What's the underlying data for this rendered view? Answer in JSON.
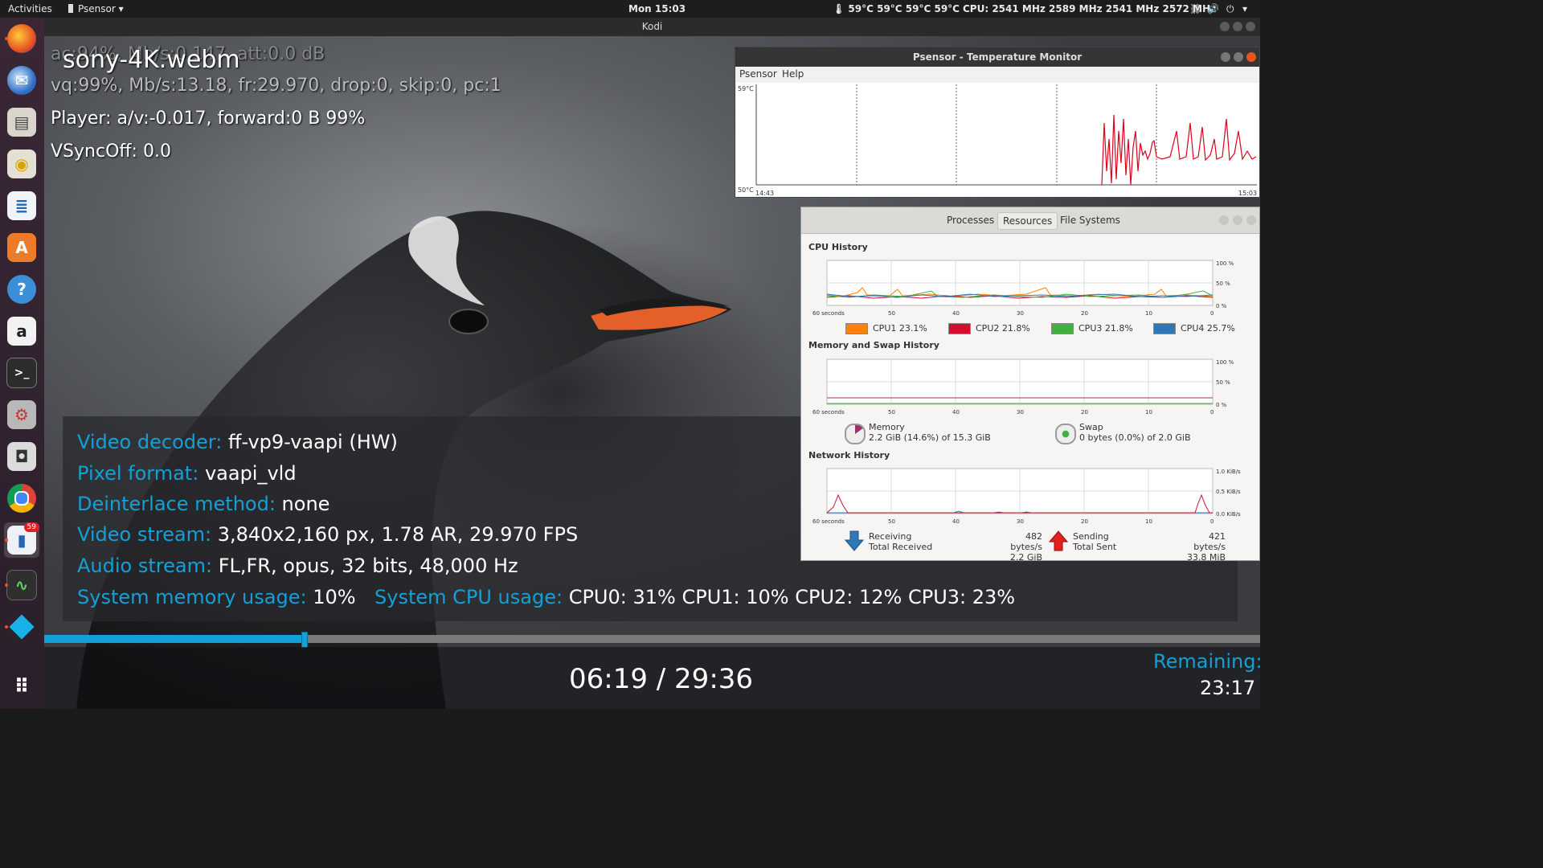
{
  "topbar": {
    "activities": "Activities",
    "app_menu": "Psensor",
    "clock": "Mon 15:03",
    "temps": "59°C 59°C 59°C 59°C",
    "cpu_freq": "CPU: 2541 MHz 2589 MHz 2541 MHz 2572 MHz"
  },
  "dock": {
    "items": [
      "firefox-icon",
      "thunderbird-icon",
      "files-icon",
      "rhythmbox-icon",
      "libreoffice-writer-icon",
      "software-center-icon",
      "help-icon",
      "amazon-icon",
      "terminal-icon",
      "settings-icon",
      "screenshot-icon",
      "chrome-icon",
      "psensor-icon",
      "system-monitor-icon",
      "kodi-icon"
    ],
    "psensor_badge": "59"
  },
  "kodi": {
    "window_title": "Kodi",
    "file_name": "sony-4K.webm",
    "ac_line": "ac:94%, Mb/s:0.147, att:0.0 dB",
    "vq_line": "vq:99%, Mb/s:13.18, fr:29.970, drop:0, skip:0, pc:1",
    "player_line": "Player: a/v:-0.017,  forward:0 B 99%",
    "vsync_line": "VSyncOff: 0.0",
    "info": {
      "video_decoder_label": "Video decoder:",
      "video_decoder_value": "ff-vp9-vaapi (HW)",
      "pixel_format_label": "Pixel format:",
      "pixel_format_value": "vaapi_vld",
      "deinterlace_label": "Deinterlace method:",
      "deinterlace_value": "none",
      "video_stream_label": "Video stream:",
      "video_stream_value": "3,840x2,160 px, 1.78 AR, 29.970 FPS",
      "audio_stream_label": "Audio stream:",
      "audio_stream_value": "FL,FR, opus, 32 bits, 48,000 Hz",
      "memory_label": "System memory usage:",
      "memory_value": "10%",
      "cpu_label": "System CPU usage:",
      "cpu_value": "CPU0:  31% CPU1:  10% CPU2:  12% CPU3:  23%"
    },
    "progress_fraction": 0.214,
    "time_display": "06:19 / 29:36",
    "remaining_label": "Remaining:",
    "remaining_value": "23:17"
  },
  "psensor": {
    "title": "Psensor - Temperature Monitor",
    "menu": [
      "Psensor",
      "Help"
    ],
    "y_max": "59°C",
    "y_min": "50°C",
    "x_start": "14:43",
    "x_end": "15:03"
  },
  "sysmon": {
    "tabs": [
      "Processes",
      "Resources",
      "File Systems"
    ],
    "active_tab": "Resources",
    "cpu_title": "CPU History",
    "mem_title": "Memory and Swap History",
    "net_title": "Network History",
    "x_labels": [
      "60 seconds",
      "50",
      "40",
      "30",
      "20",
      "10",
      "0"
    ],
    "pct_labels": [
      "100 %",
      "50 %",
      "0 %"
    ],
    "net_labels": [
      "1.0 KiB/s",
      "0.5 KiB/s",
      "0.0 KiB/s"
    ],
    "cpus": [
      {
        "name": "CPU1",
        "value": "23.1%",
        "color": "#ff7f0e"
      },
      {
        "name": "CPU2",
        "value": "21.8%",
        "color": "#d0102c"
      },
      {
        "name": "CPU3",
        "value": "21.8%",
        "color": "#3fb13f"
      },
      {
        "name": "CPU4",
        "value": "25.7%",
        "color": "#2f78b8"
      }
    ],
    "memory": {
      "label": "Memory",
      "value": "2.2 GiB (14.6%) of 15.3 GiB"
    },
    "swap": {
      "label": "Swap",
      "value": "0 bytes (0.0%) of 2.0 GiB"
    },
    "network": {
      "receiving_label": "Receiving",
      "total_received_label": "Total Received",
      "receiving_rate": "482 bytes/s",
      "total_received": "2.2 GiB",
      "sending_label": "Sending",
      "total_sent_label": "Total Sent",
      "sending_rate": "421 bytes/s",
      "total_sent": "33.8 MiB"
    }
  }
}
